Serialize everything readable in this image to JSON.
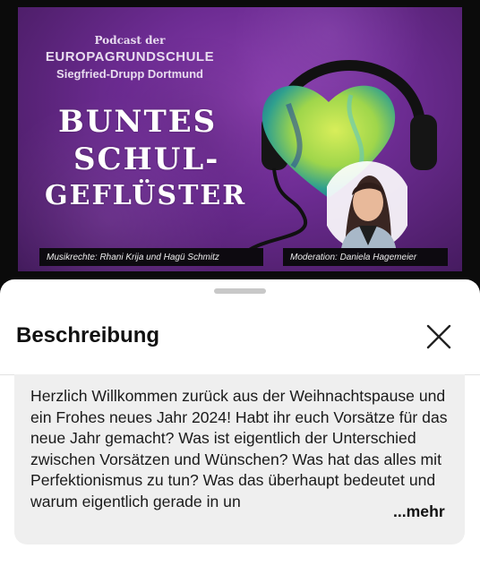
{
  "cover": {
    "podcast_line1": "Podcast der",
    "podcast_line2": "EUROPAGRUNDSCHULE",
    "podcast_line3": "Siegfried-Drupp Dortmund",
    "title_line1": "BUNTES",
    "title_line2": "SCHUL-",
    "title_line3": "GEFLÜSTER",
    "credit_music": "Musikrechte:  Rhani Krija  und  Hagü Schmitz",
    "credit_moderation": "Moderation:  Daniela Hagemeier",
    "bg_color": "#6d2c93"
  },
  "sheet": {
    "title": "Beschreibung",
    "close_icon": "close-icon",
    "description": "Herzlich Willkommen zurück aus der Weihnachtspause und ein Frohes neues Jahr 2024! Habt ihr euch Vorsätze für das neue Jahr gemacht? Was ist eigentlich der Unterschied zwischen Vorsätzen und Wünschen? Was hat das alles mit Perfektionismus zu tun? Was das überhaupt bedeutet und warum eigentlich gerade in un",
    "more_label": "...mehr"
  }
}
